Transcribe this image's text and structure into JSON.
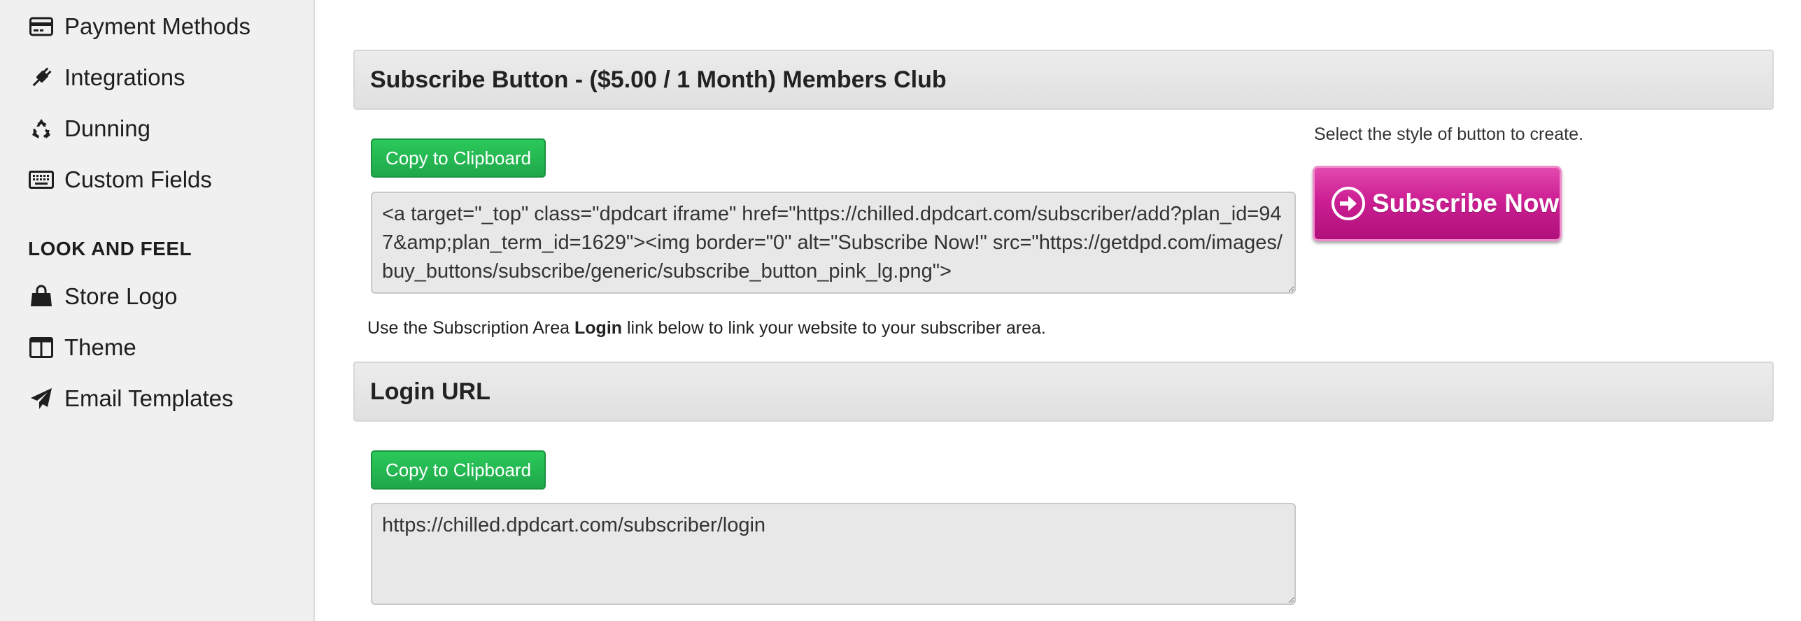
{
  "sidebar": {
    "items_top": [
      {
        "label": "Payment Methods",
        "icon": "credit-card-icon"
      },
      {
        "label": "Integrations",
        "icon": "plug-icon"
      },
      {
        "label": "Dunning",
        "icon": "recycle-icon"
      },
      {
        "label": "Custom Fields",
        "icon": "keyboard-icon"
      }
    ],
    "section_heading": "LOOK AND FEEL",
    "items_bottom": [
      {
        "label": "Store Logo",
        "icon": "shopping-bag-icon"
      },
      {
        "label": "Theme",
        "icon": "columns-icon"
      },
      {
        "label": "Email Templates",
        "icon": "paper-plane-icon"
      }
    ]
  },
  "subscribe_panel": {
    "title": "Subscribe Button - ($5.00 / 1 Month) Members Club",
    "copy_label": "Copy to Clipboard",
    "code": "<a target=\"_top\" class=\"dpdcart iframe\" href=\"https://chilled.dpdcart.com/subscriber/add?plan_id=947&amp;plan_term_id=1629\"><img border=\"0\" alt=\"Subscribe Now!\" src=\"https://getdpd.com/images/buy_buttons/subscribe/generic/subscribe_button_pink_lg.png\">",
    "style_hint": "Select the style of button to create.",
    "button_preview_label": "Subscribe Now",
    "button_color": "#cc1f93"
  },
  "info": {
    "prefix": "Use the Subscription Area ",
    "bold": "Login",
    "suffix": " link below to link your website to your subscriber area."
  },
  "login_panel": {
    "title": "Login URL",
    "copy_label": "Copy to Clipboard",
    "url": "https://chilled.dpdcart.com/subscriber/login"
  },
  "colors": {
    "copy_button": "#22b24f",
    "sidebar_bg": "#f0f0f0",
    "panel_header_bg": "#e6e6e6"
  }
}
